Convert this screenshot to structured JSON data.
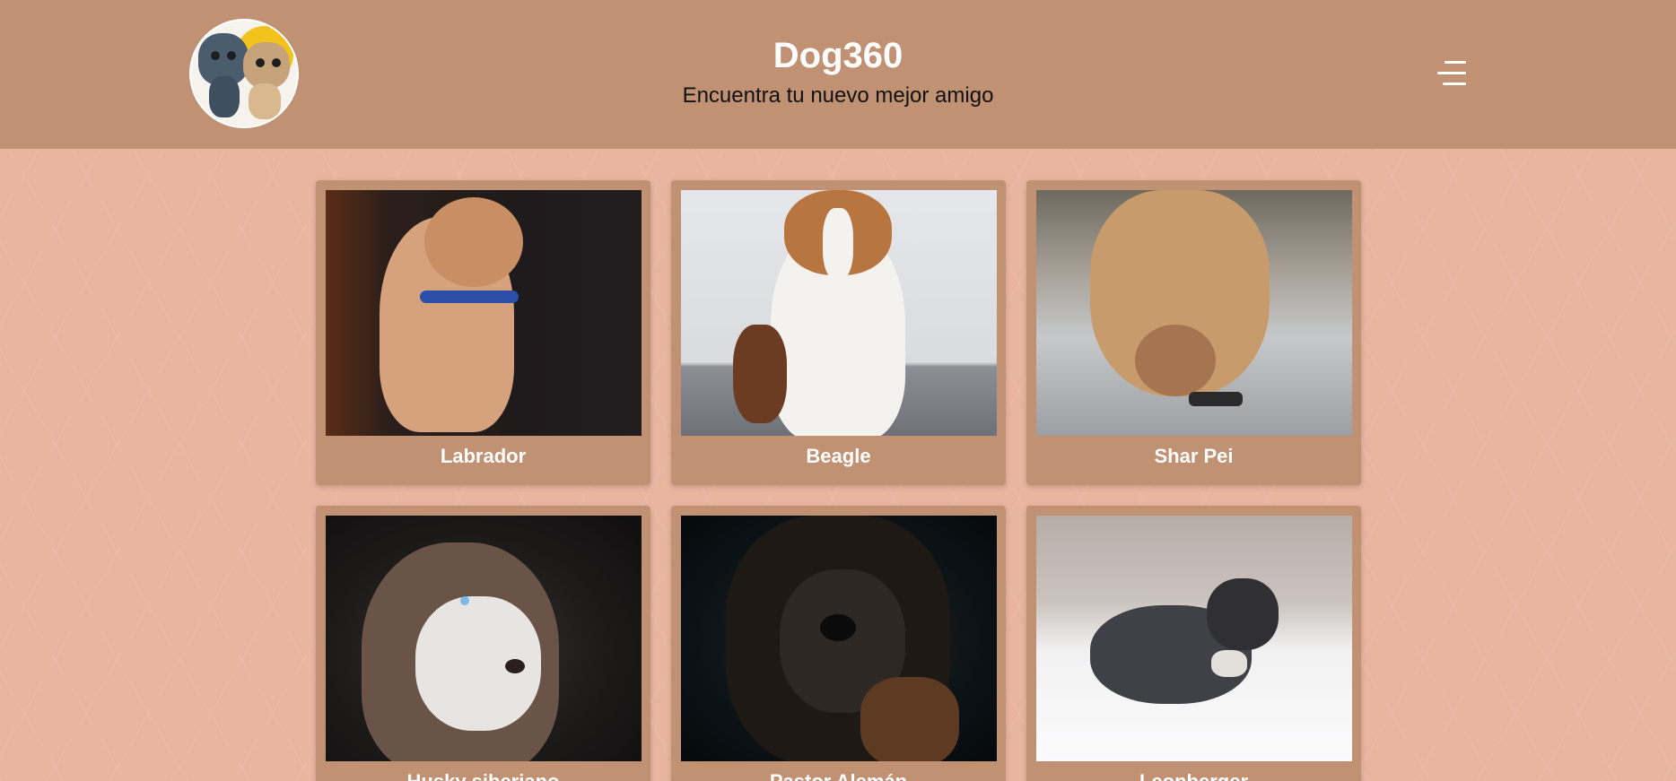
{
  "header": {
    "title": "Dog360",
    "subtitle": "Encuentra tu nuevo mejor amigo"
  },
  "colors": {
    "header_bg": "#c09173",
    "page_bg": "#e8b59f",
    "card_bg": "#c09173",
    "text_light": "#ffffff"
  },
  "cards": [
    {
      "label": "Labrador"
    },
    {
      "label": "Beagle"
    },
    {
      "label": "Shar Pei"
    },
    {
      "label": "Husky siberiano"
    },
    {
      "label": "Pastor Alemán"
    },
    {
      "label": "Leonberger"
    }
  ],
  "icons": {
    "menu": "hamburger-menu-icon",
    "logo": "logo-dogs-icon"
  }
}
